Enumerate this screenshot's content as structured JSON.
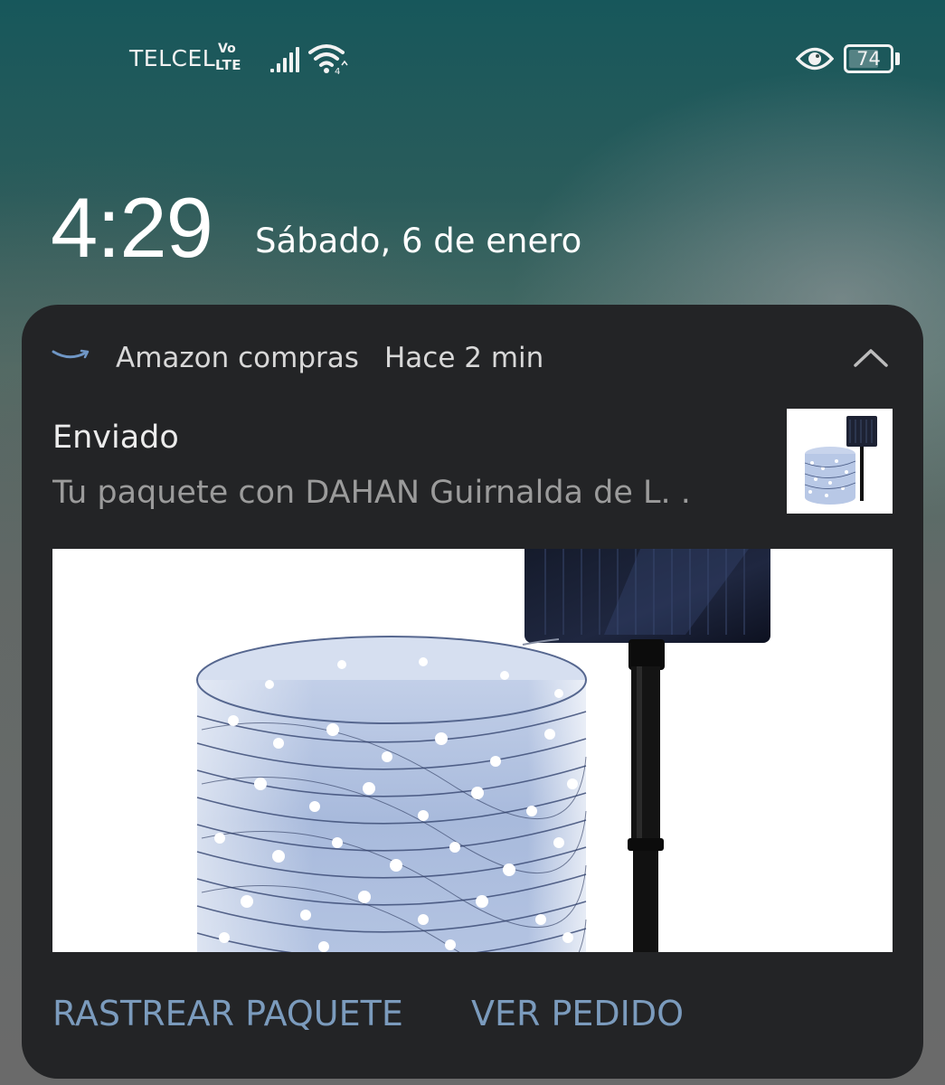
{
  "status_bar": {
    "carrier": "TELCEL",
    "volte_top": "Vo",
    "volte_bottom": "LTE",
    "battery_level": "74",
    "battery_fraction": 0.74,
    "icons": [
      "signal-icon",
      "wifi-icon",
      "eye-icon",
      "battery-icon"
    ]
  },
  "lock_screen": {
    "time": "4:29",
    "date": "Sábado, 6 de enero"
  },
  "notification": {
    "app_icon": "amazon-smile-icon",
    "app_name": "Amazon compras",
    "time_ago": "Hace 2 min",
    "title": "Enviado",
    "text": "Tu paquete con DAHAN Guirnalda de L. .",
    "actions": {
      "track": "RASTREAR PAQUETE",
      "order": "VER PEDIDO"
    },
    "colors": {
      "card": "#232426",
      "action": "#7b9bbd"
    }
  }
}
